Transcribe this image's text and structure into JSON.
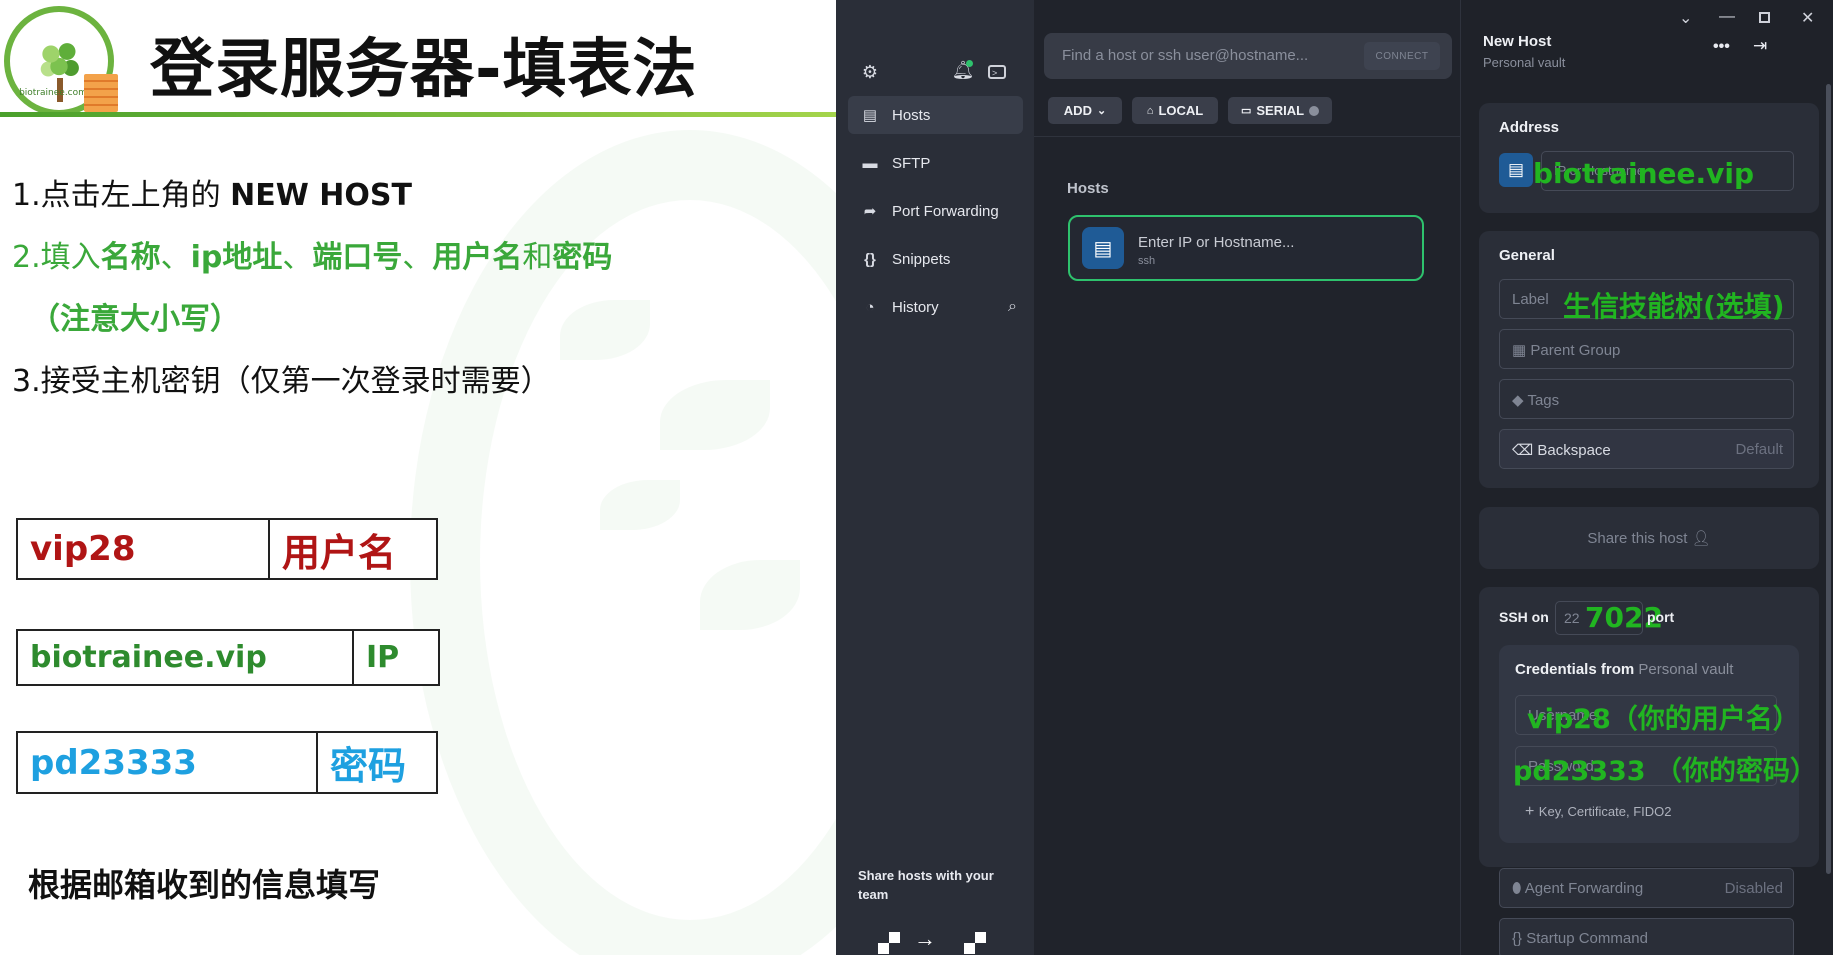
{
  "slide": {
    "title": "登录服务器-填表法",
    "logo_text": "biotrainee.com",
    "step1_prefix": "1.点击左上角的 ",
    "step1_bold": "NEW HOST",
    "step2_prefix": "2.填入",
    "step2_b1": "名称",
    "step2_s1": "、",
    "step2_b2": "ip地址",
    "step2_s2": "、",
    "step2_b3": "端口号",
    "step2_s3": "、",
    "step2_b4": "用户名",
    "step2_s4": "和",
    "step2_b5": "密码",
    "step2_line2": "（注意大小写）",
    "step3": "3.接受主机密钥（仅第一次登录时需要）",
    "info_rows": [
      {
        "value": "vip28",
        "label": "用户名",
        "color": "#b01515"
      },
      {
        "value": "biotrainee.vip",
        "label": "IP",
        "color": "#2e8b2e"
      },
      {
        "value": "pd23333",
        "label": "密码",
        "color": "#1ea0e0"
      }
    ],
    "note": "根据邮箱收到的信息填写"
  },
  "app": {
    "sidebar": {
      "items": [
        {
          "label": "Hosts",
          "icon": "hosts-icon"
        },
        {
          "label": "SFTP",
          "icon": "folder-icon"
        },
        {
          "label": "Port Forwarding",
          "icon": "forward-icon"
        },
        {
          "label": "Snippets",
          "icon": "braces-icon"
        },
        {
          "label": "History",
          "icon": "clock-icon"
        }
      ],
      "share_team": "Share hosts with your team"
    },
    "search_placeholder": "Find a host or ssh user@hostname...",
    "connect_label": "CONNECT",
    "toolbar": {
      "add": "ADD",
      "local": "LOCAL",
      "serial": "SERIAL"
    },
    "hosts_section": "Hosts",
    "new_host_card": {
      "name": "Enter IP or Hostname...",
      "sub": "ssh"
    },
    "panel": {
      "title": "New Host",
      "subtitle": "Personal vault",
      "address_title": "Address",
      "address_placeholder": "IP or Hostname",
      "general_title": "General",
      "label_placeholder": "Label",
      "parent_group": "Parent Group",
      "tags": "Tags",
      "backspace": "Backspace",
      "backspace_value": "Default",
      "share_host": "Share this host",
      "ssh_on": "SSH on",
      "port_value": "22",
      "port_label": "port",
      "credentials_from": "Credentials from",
      "credentials_vault": "Personal vault",
      "username_placeholder": "Username",
      "password_placeholder": "Password",
      "key_cert": "Key, Certificate, FIDO2",
      "agent_forwarding": "Agent Forwarding",
      "agent_value": "Disabled",
      "startup_command": "Startup Command"
    },
    "annotations": {
      "address": "biotrainee.vip",
      "label": "生信技能树(选填)",
      "port": "7022",
      "username": "vip28（你的用户名）",
      "password": "pd23333 （你的密码）"
    },
    "colors": {
      "accent_green": "#2ec26d",
      "annotation_green": "#21b521",
      "host_icon_blue": "#1f5b96"
    }
  }
}
